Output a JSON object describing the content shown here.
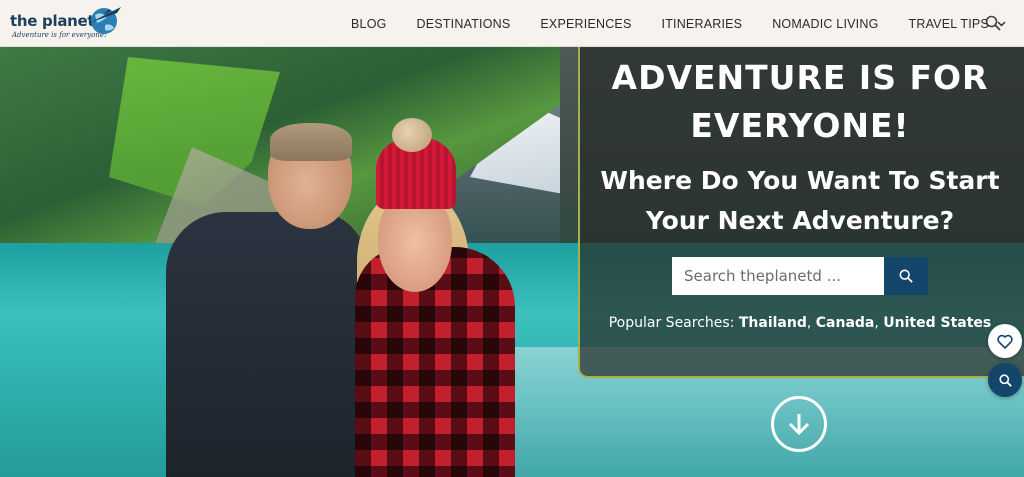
{
  "header": {
    "logo_text": "the planet",
    "logo_tagline": "Adventure is for everyone!",
    "nav": [
      {
        "label": "BLOG"
      },
      {
        "label": "DESTINATIONS"
      },
      {
        "label": "EXPERIENCES"
      },
      {
        "label": "ITINERARIES"
      },
      {
        "label": "NOMADIC LIVING"
      },
      {
        "label": "TRAVEL TIPS"
      }
    ],
    "search_icon": "search-icon",
    "dropdown_icon": "chevron-down-icon"
  },
  "hero": {
    "title": "ADVENTURE IS FOR EVERYONE!",
    "subtitle": "Where Do You Want To Start Your Next Adventure?",
    "search": {
      "placeholder": "Search theplanetd ..."
    },
    "popular_label": "Popular Searches:",
    "popular_terms": [
      "Thailand",
      "Canada",
      "United States"
    ],
    "scroll_icon": "arrow-down-circle-icon"
  },
  "floating": {
    "heart_icon": "heart-icon",
    "search_icon": "search-icon"
  },
  "colors": {
    "accent": "#14466b",
    "panel_border": "#a9b04a",
    "header_bg": "#f6f2ed"
  }
}
